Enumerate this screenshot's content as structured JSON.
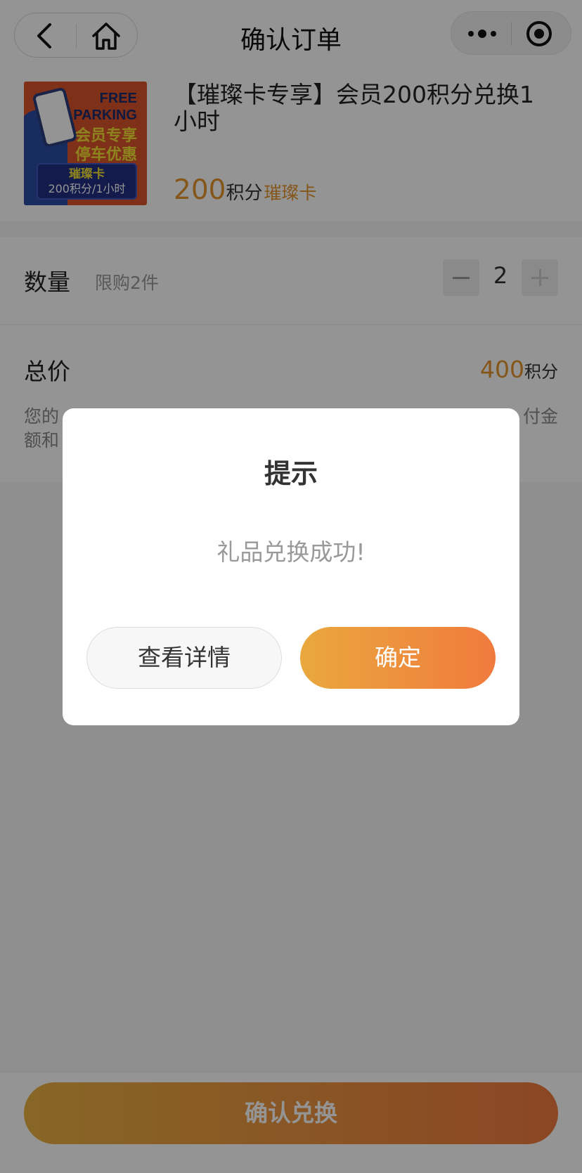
{
  "navbar": {
    "title": "确认订单"
  },
  "product": {
    "image_text": {
      "free": "FREE",
      "parking": "PARKING",
      "line1": "会员专享",
      "line2": "停车优惠",
      "badge_title": "璀璨卡",
      "badge_sub": "200积分/1小时"
    },
    "title": "【璀璨卡专享】会员200积分兑换1小时",
    "price": "200",
    "price_unit": "积分",
    "card_tag": "璀璨卡"
  },
  "quantity": {
    "label": "数量",
    "limit": "限购2件",
    "value": "2"
  },
  "total": {
    "label": "总价",
    "value": "400",
    "unit": "积分",
    "note_start": "您的",
    "note_end": "付金",
    "note_line2": "额和"
  },
  "bottom": {
    "confirm_label": "确认兑换"
  },
  "modal": {
    "title": "提示",
    "message": "礼品兑换成功!",
    "detail_button": "查看详情",
    "ok_button": "确定"
  },
  "colors": {
    "accent": "#e6952e",
    "gradient_start": "#eab143",
    "gradient_end": "#f07a3d"
  }
}
